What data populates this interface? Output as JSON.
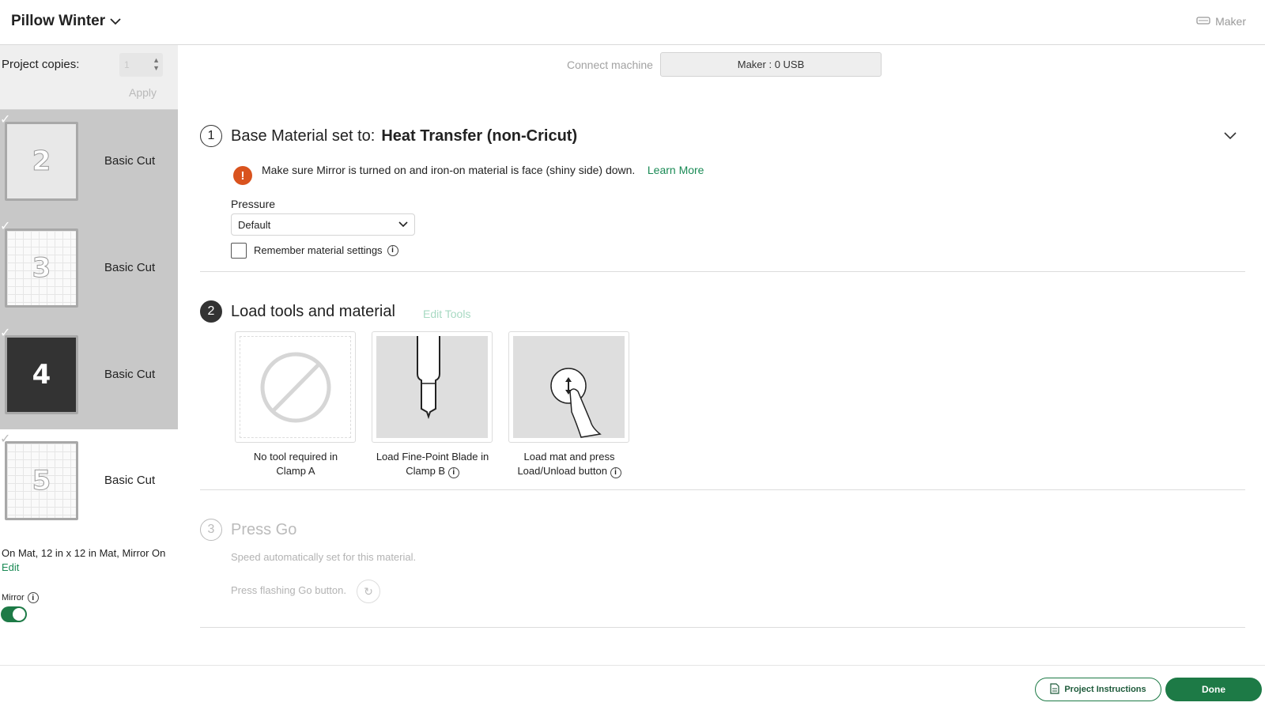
{
  "header": {
    "project_title": "Pillow Winter",
    "machine_label": "Maker"
  },
  "sidebar": {
    "copies_label": "Project copies:",
    "copies_value": "1",
    "apply_label": "Apply",
    "mats": [
      {
        "number": "2",
        "label": "Basic Cut",
        "selected": true
      },
      {
        "number": "3",
        "label": "Basic Cut",
        "selected": true
      },
      {
        "number": "4",
        "label": "Basic Cut",
        "selected": true
      },
      {
        "number": "5",
        "label": "Basic Cut",
        "selected": false
      }
    ],
    "mat_info": "On Mat, 12 in x 12 in Mat, Mirror On",
    "edit_label": "Edit",
    "mirror_label": "Mirror",
    "mirror_on": true
  },
  "connect": {
    "label": "Connect machine",
    "value": "Maker : 0 USB"
  },
  "step1": {
    "number": "1",
    "title": "Base Material set to:",
    "material": "Heat Transfer (non-Cricut)",
    "warning": "Make sure Mirror is turned on and iron-on material is face (shiny side) down.",
    "learn_more": "Learn More",
    "pressure_label": "Pressure",
    "pressure_value": "Default",
    "remember_label": "Remember material settings"
  },
  "step2": {
    "number": "2",
    "title": "Load tools and material",
    "edit_tools": "Edit Tools",
    "tools": [
      {
        "caption_line1": "No tool required in",
        "caption_line2": "Clamp A"
      },
      {
        "caption_line1": "Load Fine-Point Blade in",
        "caption_line2": "Clamp B"
      },
      {
        "caption_line1": "Load mat and press",
        "caption_line2": "Load/Unload button"
      }
    ]
  },
  "step3": {
    "number": "3",
    "title": "Press Go",
    "speed_text": "Speed automatically set for this material.",
    "go_text": "Press flashing Go button."
  },
  "footer": {
    "instructions_label": "Project Instructions",
    "done_label": "Done"
  },
  "colors": {
    "accent": "#1d7a46",
    "warning": "#d9531e",
    "link": "#1a8a55"
  }
}
